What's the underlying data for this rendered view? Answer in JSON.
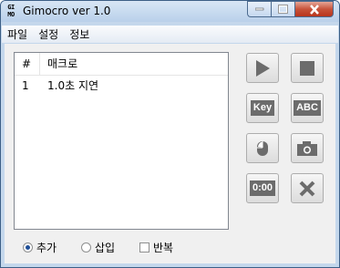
{
  "window": {
    "title": "Gimocro ver 1.0",
    "icon_text": "GI MO"
  },
  "menu": {
    "items": [
      "파일",
      "설정",
      "정보"
    ]
  },
  "list": {
    "columns": [
      "#",
      "매크로"
    ],
    "rows": [
      {
        "num": "1",
        "name": "1.0초 지연"
      }
    ]
  },
  "toolbar": {
    "play_icon": "play-icon",
    "stop_icon": "stop-icon",
    "key_label": "Key",
    "abc_label": "ABC",
    "mouse_icon": "mouse-icon",
    "camera_icon": "camera-icon",
    "time_label": "0:00",
    "delete_icon": "x-icon"
  },
  "options": {
    "add_label": "추가",
    "insert_label": "삽입",
    "repeat_label": "반복",
    "selected": "추가"
  }
}
